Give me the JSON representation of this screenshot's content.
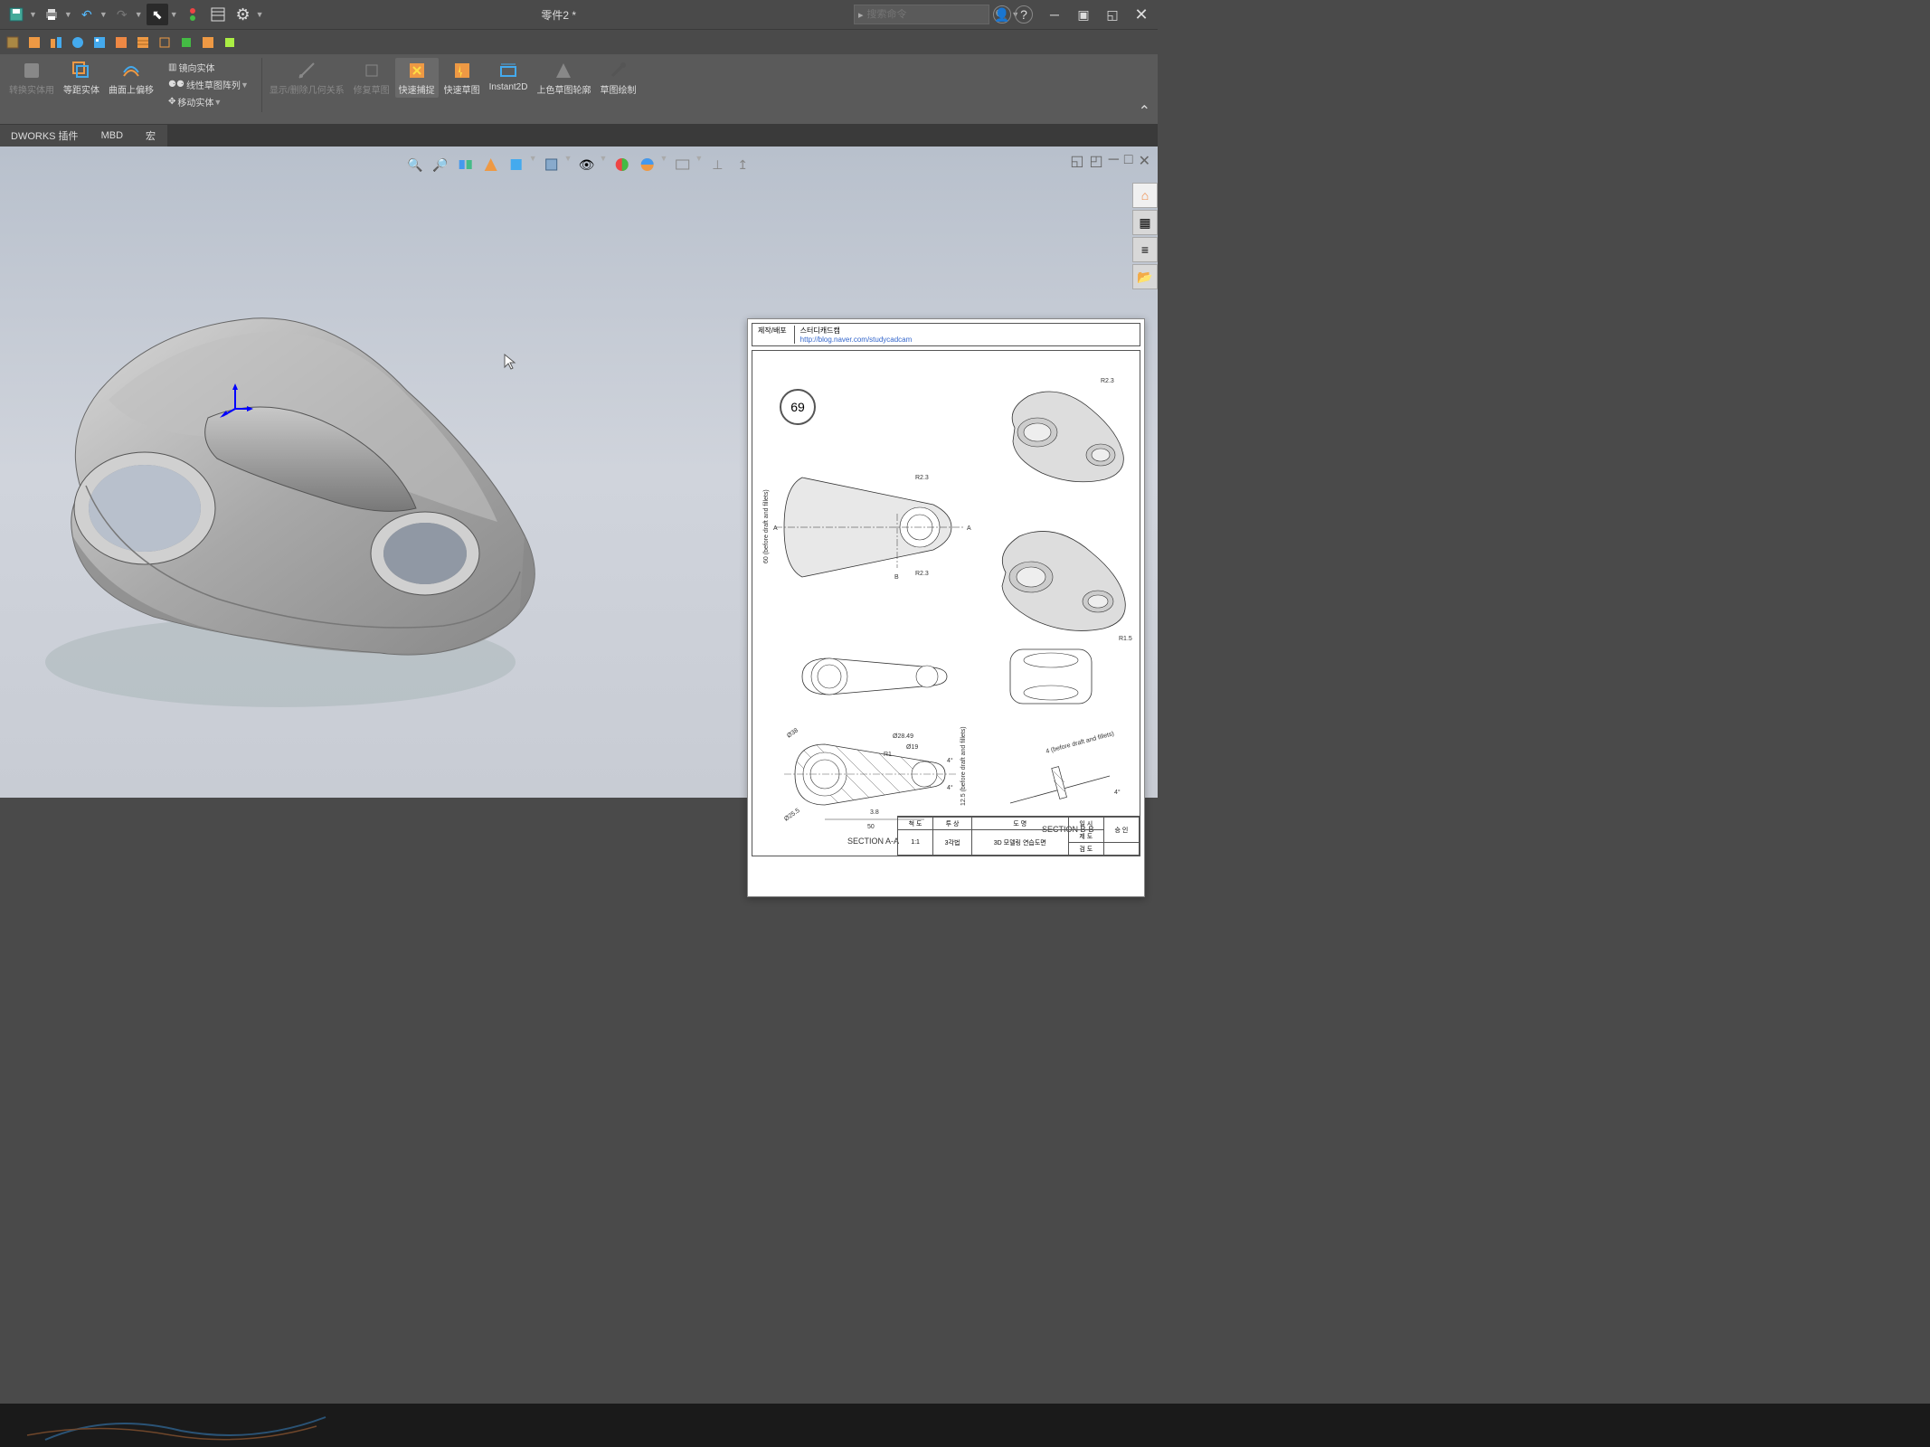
{
  "title": "零件2 *",
  "search": {
    "placeholder": "搜索命令"
  },
  "quick_access": [
    "save",
    "print",
    "undo",
    "redo",
    "select",
    "rebuild",
    "options",
    "settings"
  ],
  "ribbon": {
    "items": [
      {
        "label": "转换实体用",
        "dim": false
      },
      {
        "label": "等距实体",
        "dim": false
      },
      {
        "label": "曲面上偏移",
        "dim": false
      }
    ],
    "small_items": [
      {
        "label": "镜向实体"
      },
      {
        "label": "线性草图阵列"
      },
      {
        "label": "移动实体"
      }
    ],
    "group2": [
      {
        "label": "显示/删除几何关系",
        "dim": true
      },
      {
        "label": "修复草图",
        "dim": true
      },
      {
        "label": "快速捕捉",
        "dim": false
      },
      {
        "label": "快速草图",
        "dim": false
      },
      {
        "label": "Instant2D",
        "dim": false
      },
      {
        "label": "上色草图轮廓",
        "dim": false
      },
      {
        "label": "草图绘制",
        "dim": false
      }
    ]
  },
  "tabs": [
    {
      "label": "DWORKS 插件",
      "active": false
    },
    {
      "label": "MBD",
      "active": false
    },
    {
      "label": "宏",
      "active": false
    }
  ],
  "drawing": {
    "header_label": "제작/배포",
    "header_title": "스터디캐드캠",
    "header_url": "http://blog.naver.com/studycadcam",
    "number": "69",
    "dims": {
      "r23": "R2.3",
      "r15": "R1.5",
      "r1": "R1",
      "d38": "Ø38",
      "d255": "Ø25.5",
      "d2849": "Ø28.49",
      "d19": "Ø19",
      "h60": "60 (before draft and fillets)",
      "h125": "12.5 (before draft and fillets)",
      "h4": "4 (before draft and fillets)",
      "w50": "50",
      "w38": "3.8",
      "ang4": "4°",
      "secA": "A",
      "secB": "B"
    },
    "section_a": "SECTION A-A",
    "section_b": "SECTION B-B",
    "titleblock": {
      "col_scale": "척 도",
      "col_proj": "투 상",
      "col_name": "도 명",
      "col_date": "일 시",
      "col_appr": "승 인",
      "scale": "1:1",
      "proj": "3각법",
      "name": "3D 모델링 연습도면",
      "row_draw": "제 도",
      "row_check": "검 도"
    }
  }
}
